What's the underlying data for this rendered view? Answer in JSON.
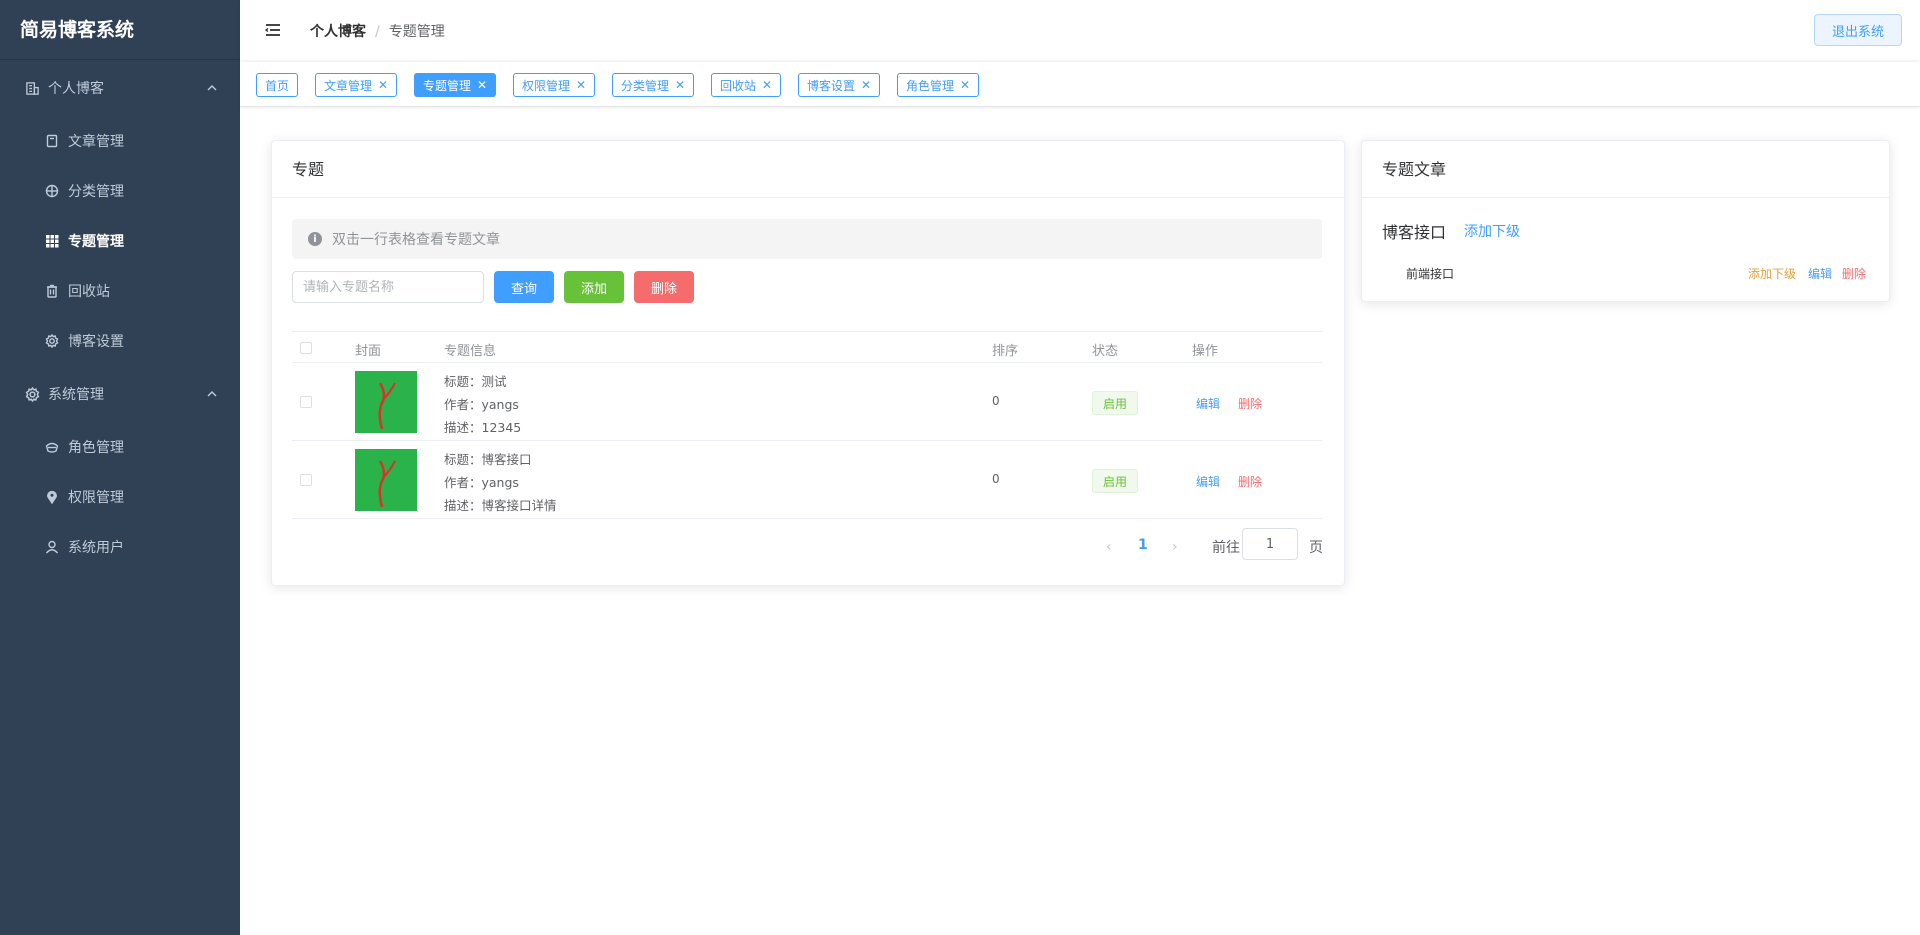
{
  "app": {
    "brand": "简易博客系统"
  },
  "sidebar": {
    "groups": [
      {
        "label": "个人博客",
        "items": [
          {
            "label": "文章管理",
            "icon": "book-icon"
          },
          {
            "label": "分类管理",
            "icon": "target-icon"
          },
          {
            "label": "专题管理",
            "icon": "grid-icon",
            "active": true
          },
          {
            "label": "回收站",
            "icon": "trash-icon"
          },
          {
            "label": "博客设置",
            "icon": "gear-icon"
          }
        ]
      },
      {
        "label": "系统管理",
        "items": [
          {
            "label": "角色管理",
            "icon": "role-icon"
          },
          {
            "label": "权限管理",
            "icon": "pin-icon"
          },
          {
            "label": "系统用户",
            "icon": "user-icon"
          }
        ]
      }
    ]
  },
  "header": {
    "breadcrumb": [
      "个人博客",
      "专题管理"
    ],
    "separator": "/",
    "logout_label": "退出系统"
  },
  "tags": [
    {
      "label": "首页",
      "closable": false
    },
    {
      "label": "文章管理",
      "closable": true
    },
    {
      "label": "专题管理",
      "closable": true,
      "active": true
    },
    {
      "label": "权限管理",
      "closable": true
    },
    {
      "label": "分类管理",
      "closable": true
    },
    {
      "label": "回收站",
      "closable": true
    },
    {
      "label": "博客设置",
      "closable": true
    },
    {
      "label": "角色管理",
      "closable": true
    }
  ],
  "topics_panel": {
    "title": "专题",
    "tip": "双击一行表格查看专题文章",
    "search_placeholder": "请输入专题名称",
    "buttons": {
      "query": "查询",
      "add": "添加",
      "delete": "删除"
    },
    "columns": [
      "封面",
      "专题信息",
      "排序",
      "状态",
      "操作"
    ],
    "rows": [
      {
        "title": "标题：测试",
        "author": "作者：yangs",
        "desc": "描述：12345",
        "sort": "0",
        "status": "启用",
        "edit": "编辑",
        "delete": "删除"
      },
      {
        "title": "标题：博客接口",
        "author": "作者：yangs",
        "desc": "描述：博客接口详情",
        "sort": "0",
        "status": "启用",
        "edit": "编辑",
        "delete": "删除"
      }
    ],
    "pagination": {
      "current": "1",
      "goto_label": "前往",
      "goto_value": "1",
      "page_suffix": "页"
    }
  },
  "articles_panel": {
    "title": "专题文章",
    "root": {
      "label": "博客接口",
      "add_child": "添加下级"
    },
    "children": [
      {
        "label": "前端接口",
        "add_child": "添加下级",
        "edit": "编辑",
        "delete": "删除"
      }
    ]
  },
  "colors": {
    "sidebar_bg": "#304156",
    "primary": "#409eff",
    "success": "#67c23a",
    "danger": "#f56c6c",
    "warning": "#e6a23c",
    "cover_bg": "#2ab34a"
  }
}
